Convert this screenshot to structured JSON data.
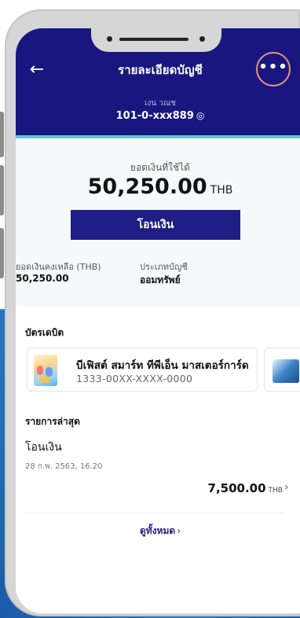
{
  "header": {
    "title": "รายละเอียดบัญชี",
    "back_icon": "arrow-left-icon",
    "more_label": "•••",
    "account_name": "เงน วณช",
    "account_number": "101-0-xxx889",
    "eye_icon": "◎"
  },
  "balance": {
    "label": "ยอดเงินที่ใช้ได้",
    "amount": "50,250.00",
    "currency": "THB"
  },
  "transfer_button": "โอนเงิน",
  "stats": {
    "remaining_label": "ยอดเงินคงเหลือ (THB)",
    "remaining_value": "50,250.00",
    "type_label": "ประเภทบัญชี",
    "type_value": "ออมทรัพย์"
  },
  "debit_cards": {
    "section_title": "บัตรเดบิต",
    "cards": [
      {
        "name": "บีเฟิสต์ สมาร์ท ทีพีเอ็น มาสเตอร์การ์ด",
        "number": "1333-00XX-XXXX-0000"
      }
    ]
  },
  "recent": {
    "section_title": "รายการล่าสุด",
    "items": [
      {
        "title": "โอนเงิน",
        "date": "28 ก.พ. 2563, 16.20",
        "amount": "7,500.00",
        "currency": "THB"
      }
    ],
    "view_all": "ดูทั้งหมด",
    "chevron": "›"
  },
  "colors": {
    "header_bg": "#19177f",
    "accent_stripe": "#5ec7d6",
    "button_bg": "#1f1e86",
    "highlight_ring": "#e8947c"
  }
}
